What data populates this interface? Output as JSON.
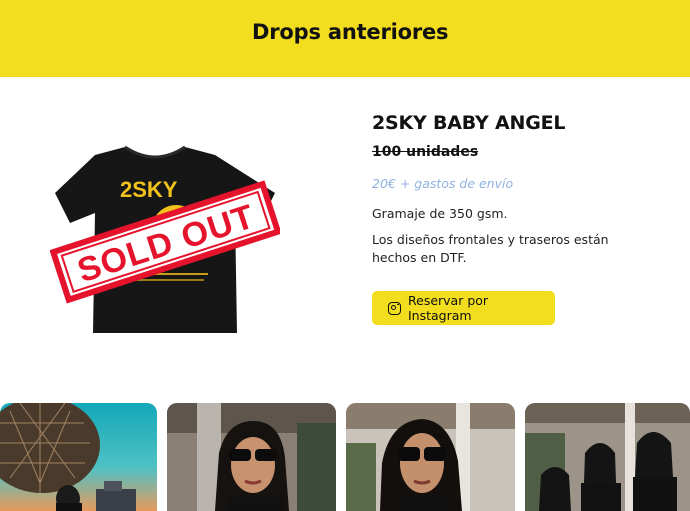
{
  "header": {
    "title": "Drops anteriores"
  },
  "product": {
    "image": {
      "shirt_print_text": "2SKY",
      "stamp_text": "SOLD OUT",
      "shirt_color": "#161616",
      "stamp_color": "#e5132c",
      "print_color": "#f2c21c"
    },
    "title": "2SKY BABY ANGEL",
    "quantity": "100 unidades",
    "price": "20€ + gastos de envío",
    "weight": "Gramaje de 350 gsm.",
    "description": "Los diseños frontales y traseros están hechos en DTF.",
    "cta": {
      "label": "Reservar por Instagram",
      "icon": "instagram-icon"
    }
  },
  "gallery": {
    "photos": [
      {
        "name": "gallery-photo-1",
        "scene": "geodesic-dome-sky"
      },
      {
        "name": "gallery-photo-2",
        "scene": "portrait-sunglasses"
      },
      {
        "name": "gallery-photo-3",
        "scene": "portrait-sunglasses-wall"
      },
      {
        "name": "gallery-photo-4",
        "scene": "group-of-three"
      }
    ]
  },
  "colors": {
    "accent": "#f2dd1f",
    "price": "#8fb2e0",
    "text": "#111111"
  }
}
